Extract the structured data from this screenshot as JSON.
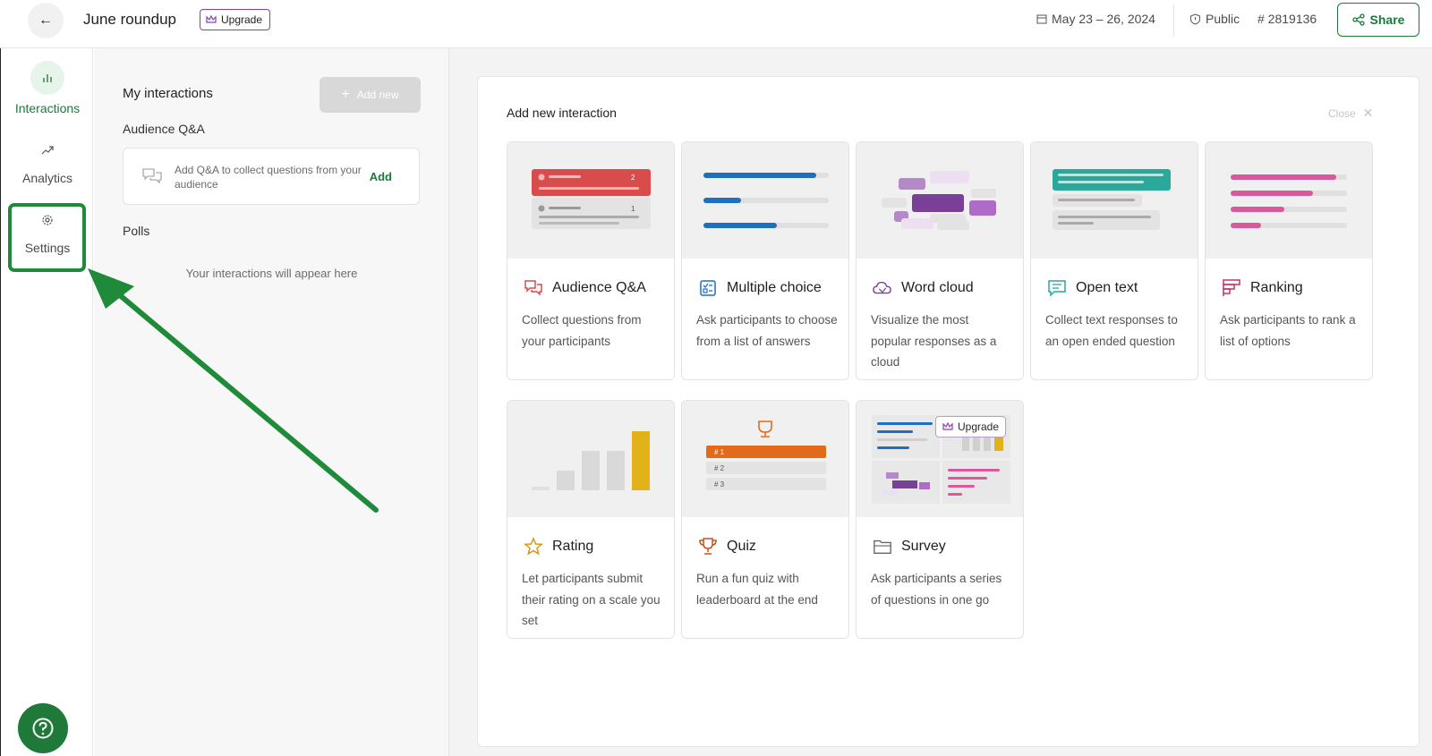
{
  "header": {
    "back_icon": "arrow-left-icon",
    "title": "June roundup",
    "upgrade_label": "Upgrade",
    "date_range": "May 23 – 26, 2024",
    "visibility": "Public",
    "event_code": "# 2819136",
    "share_label": "Share"
  },
  "rail": {
    "items": [
      {
        "label": "Interactions",
        "icon": "bar-chart-icon",
        "active": true
      },
      {
        "label": "Analytics",
        "icon": "trend-up-icon",
        "active": false
      },
      {
        "label": "Settings",
        "icon": "gear-icon",
        "active": false
      }
    ],
    "help_icon": "question-mark-icon"
  },
  "interactions_panel": {
    "title": "My interactions",
    "add_new_label": "Add new",
    "qa_heading": "Audience Q&A",
    "qa_card_text": "Add Q&A to collect questions from your audience",
    "qa_card_action": "Add",
    "polls_heading": "Polls",
    "empty_text": "Your interactions will appear here"
  },
  "add_panel": {
    "title": "Add new interaction",
    "close_label": "Close",
    "cards": [
      {
        "title": "Audience Q&A",
        "description": "Collect questions from your participants",
        "icon": "speech-bubbles-icon"
      },
      {
        "title": "Multiple choice",
        "description": "Ask participants to choose from a list of answers",
        "icon": "checklist-icon"
      },
      {
        "title": "Word cloud",
        "description": "Visualize the most popular responses as a cloud",
        "icon": "cloud-icon"
      },
      {
        "title": "Open text",
        "description": "Collect text responses to an open ended question",
        "icon": "message-lines-icon"
      },
      {
        "title": "Ranking",
        "description": "Ask participants to rank a list of options",
        "icon": "ranking-bars-icon"
      },
      {
        "title": "Rating",
        "description": "Let participants submit their rating on a scale you set",
        "icon": "star-icon"
      },
      {
        "title": "Quiz",
        "description": "Run a fun quiz with leaderboard at the end",
        "icon": "trophy-icon"
      },
      {
        "title": "Survey",
        "description": "Ask participants a series of questions in one go",
        "icon": "folder-icon",
        "badge": "Upgrade"
      }
    ],
    "qa_preview": {
      "first_count": "2",
      "second_count": "1"
    },
    "quiz_preview": {
      "ranks": [
        "# 1",
        "# 2",
        "# 3"
      ]
    }
  },
  "colors": {
    "brand_green": "#1a7a3a",
    "qa_red": "#d94c4c",
    "mc_blue": "#1f6fc0",
    "word_purple": "#7a3f96",
    "open_teal": "#2aa89a",
    "rank_pink": "#d85a9c",
    "rating_yellow": "#e2b21b",
    "quiz_orange": "#e26a1b"
  }
}
